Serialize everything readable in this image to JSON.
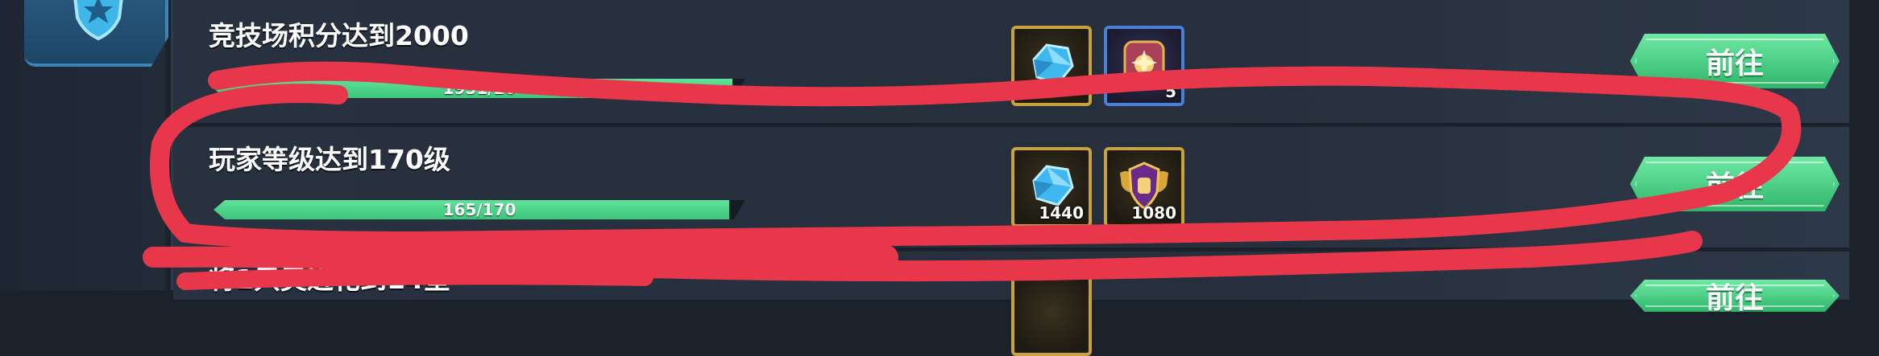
{
  "tasks": [
    {
      "title": "竞技场积分达到2000",
      "progress_text": "1951/20",
      "progress_fraction": 0.976,
      "rewards": [
        {
          "icon": "blue-crystal-icon",
          "frame": "gold",
          "amount": ""
        },
        {
          "icon": "emblem-badge-icon",
          "frame": "blue",
          "amount": "5"
        }
      ],
      "button_label": "前往"
    },
    {
      "title": "玩家等级达到170级",
      "progress_text": "165/170",
      "progress_fraction": 0.97,
      "rewards": [
        {
          "icon": "blue-crystal-icon",
          "frame": "gold",
          "amount": "1440"
        },
        {
          "icon": "winged-shield-icon",
          "frame": "gold",
          "amount": "1080"
        }
      ],
      "button_label": "前往"
    },
    {
      "title": "将1只灵进化到14星",
      "button_label": "前往"
    }
  ],
  "colors": {
    "progress_fill": "#4fd98b",
    "button_green": "#3fc47a",
    "annotation_red": "#e8374a"
  }
}
